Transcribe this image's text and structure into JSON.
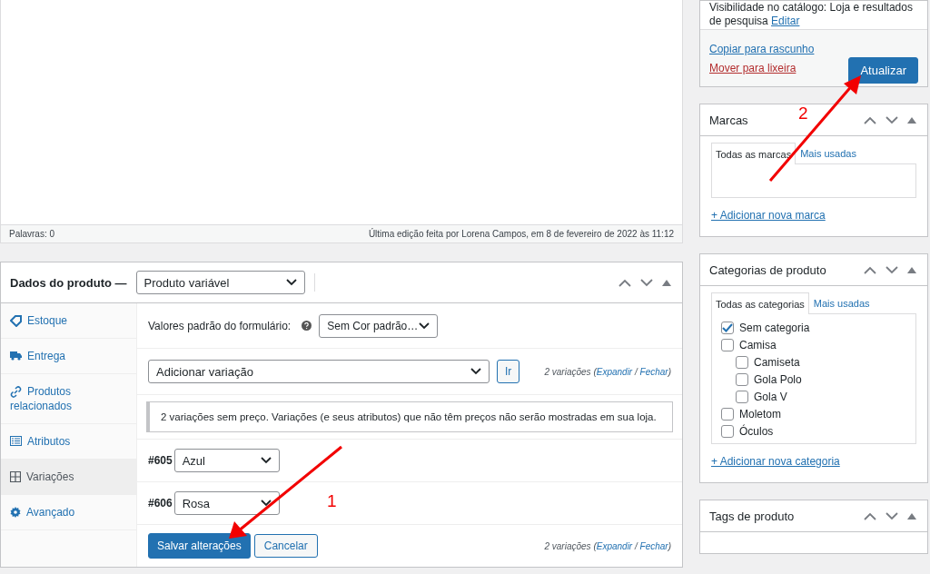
{
  "editor": {
    "word_count": "Palavras: 0",
    "last_edit": "Última edição feita por Lorena Campos, em 8 de fevereiro de 2022 às 11:12"
  },
  "product_data": {
    "title": "Dados do produto —",
    "type_select": "Produto variável",
    "tabs": [
      {
        "label": "Estoque",
        "kind": "tag",
        "selected": false
      },
      {
        "label": "Entrega",
        "kind": "truck",
        "selected": false
      },
      {
        "label": "Produtos relacionados",
        "kind": "link",
        "selected": false
      },
      {
        "label": "Atributos",
        "kind": "list",
        "selected": false
      },
      {
        "label": "Variações",
        "kind": "grid",
        "selected": true
      },
      {
        "label": "Avançado",
        "kind": "gear",
        "selected": false
      }
    ],
    "defaults_label": "Valores padrão do formulário:",
    "default_select": "Sem Cor padrão…",
    "add_select": "Adicionar variação",
    "go_button": "Ir",
    "count_top": {
      "prefix": "2 variações (",
      "expand": "Expandir",
      "separator": "/",
      "close": "Fechar",
      "suffix": ")"
    },
    "notice": "2 variações sem preço. Variações (e seus atributos) que não têm preços não serão mostradas em sua loja.",
    "variations": [
      {
        "id": "#605",
        "value": "Azul"
      },
      {
        "id": "#606",
        "value": "Rosa"
      }
    ],
    "save_button": "Salvar alterações",
    "cancel_button": "Cancelar",
    "count_bottom": {
      "prefix": "2 variações (",
      "expand": "Expandir",
      "separator": "/",
      "close": "Fechar",
      "suffix": ")"
    }
  },
  "publish": {
    "visibility": "Visibilidade no catálogo: Loja e resultados",
    "visibility_2": "de pesquisa",
    "edit_link": "Editar",
    "copy_link": "Copiar para rascunho",
    "trash_link": "Mover para lixeira",
    "update_button": "Atualizar"
  },
  "brands": {
    "title": "Marcas",
    "tabs": [
      {
        "label": "Todas as marcas",
        "selected": true
      },
      {
        "label": "Mais usadas",
        "selected": false
      }
    ],
    "add_link": "+ Adicionar nova marca"
  },
  "categories": {
    "title": "Categorias de produto",
    "tabs": [
      {
        "label": "Todas as categorias",
        "selected": true
      },
      {
        "label": "Mais usadas",
        "selected": false
      }
    ],
    "items": [
      {
        "label": "Sem categoria",
        "checked": true
      },
      {
        "label": "Camisa",
        "checked": false,
        "children": [
          {
            "label": "Camiseta",
            "checked": false
          },
          {
            "label": "Gola Polo",
            "checked": false
          },
          {
            "label": "Gola V",
            "checked": false
          }
        ]
      },
      {
        "label": "Moletom",
        "checked": false
      },
      {
        "label": "Óculos",
        "checked": false
      }
    ],
    "add_link": "+ Adicionar nova categoria"
  },
  "tags": {
    "title": "Tags de produto"
  },
  "annotations": [
    {
      "label": "1"
    },
    {
      "label": "2"
    }
  ]
}
